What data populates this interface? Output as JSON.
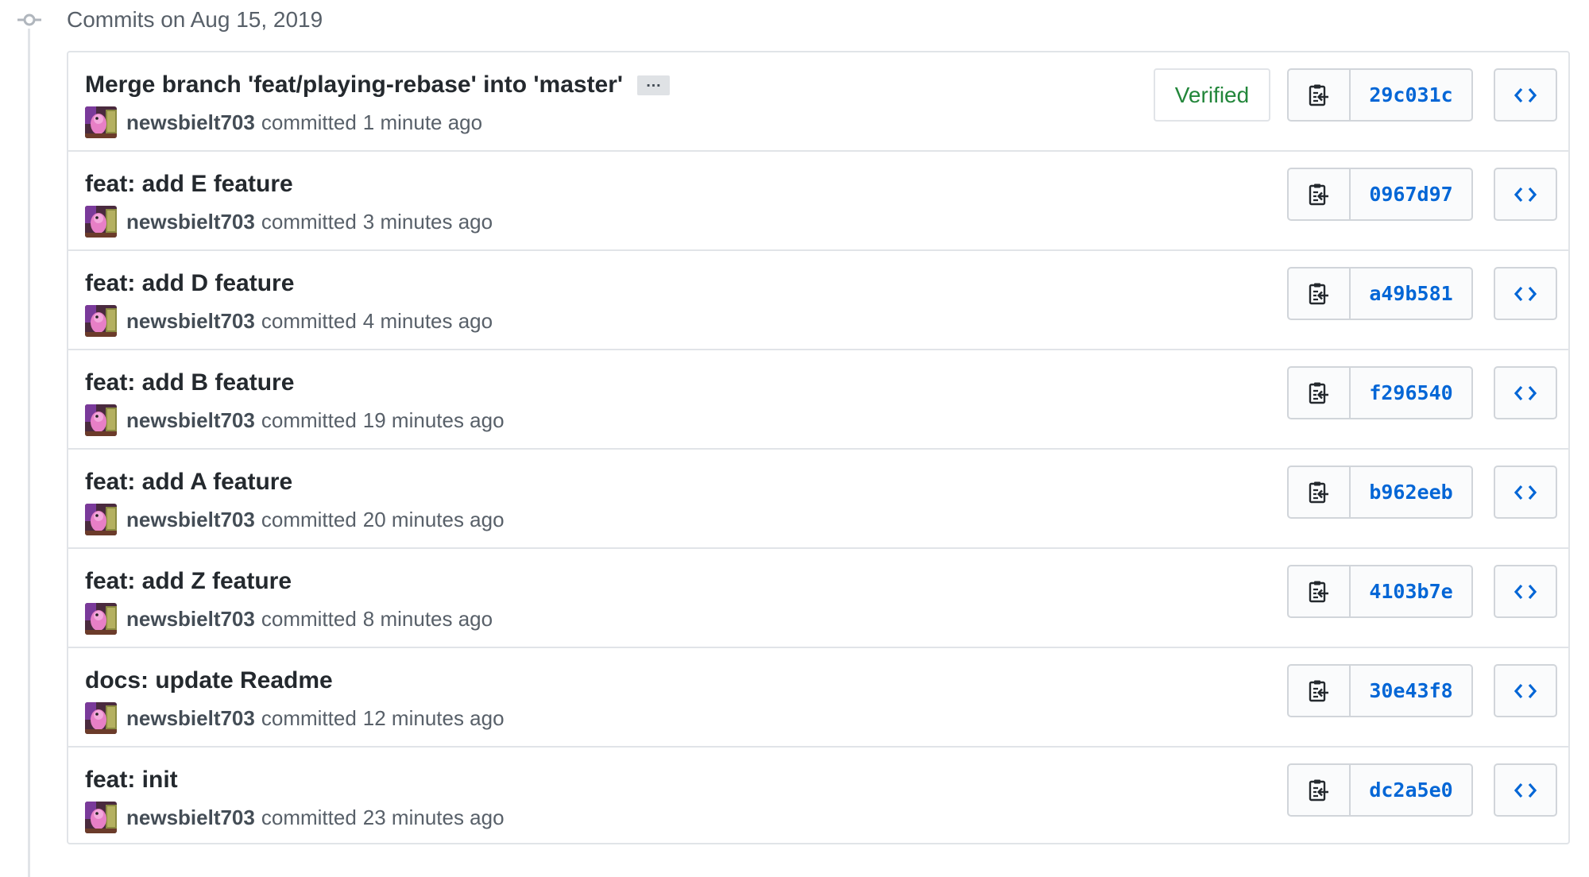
{
  "group": {
    "title": "Commits on Aug 15, 2019"
  },
  "commits": [
    {
      "title": "Merge branch 'feat/playing-rebase' into 'master'",
      "has_ellipsis": true,
      "ellipsis_label": "…",
      "author": "newsbielt703",
      "action": "committed",
      "time": "1 minute ago",
      "verified": true,
      "verified_label": "Verified",
      "sha": "29c031c"
    },
    {
      "title": "feat: add E feature",
      "author": "newsbielt703",
      "action": "committed",
      "time": "3 minutes ago",
      "sha": "0967d97"
    },
    {
      "title": "feat: add D feature",
      "author": "newsbielt703",
      "action": "committed",
      "time": "4 minutes ago",
      "sha": "a49b581"
    },
    {
      "title": "feat: add B feature",
      "author": "newsbielt703",
      "action": "committed",
      "time": "19 minutes ago",
      "sha": "f296540"
    },
    {
      "title": "feat: add A feature",
      "author": "newsbielt703",
      "action": "committed",
      "time": "20 minutes ago",
      "sha": "b962eeb"
    },
    {
      "title": "feat: add Z feature",
      "author": "newsbielt703",
      "action": "committed",
      "time": "8 minutes ago",
      "sha": "4103b7e"
    },
    {
      "title": "docs: update Readme",
      "author": "newsbielt703",
      "action": "committed",
      "time": "12 minutes ago",
      "sha": "30e43f8"
    },
    {
      "title": "feat: init",
      "author": "newsbielt703",
      "action": "committed",
      "time": "23 minutes ago",
      "sha": "dc2a5e0"
    }
  ],
  "icons": {
    "timeline": "git-commit-icon",
    "avatar": "user-avatar",
    "copy": "clipboard-copy-icon",
    "browse": "code-brackets-icon"
  },
  "colors": {
    "link": "#0366d6",
    "verified": "#22863a",
    "border": "#e1e4e8",
    "text": "#24292e",
    "muted": "#586069"
  }
}
